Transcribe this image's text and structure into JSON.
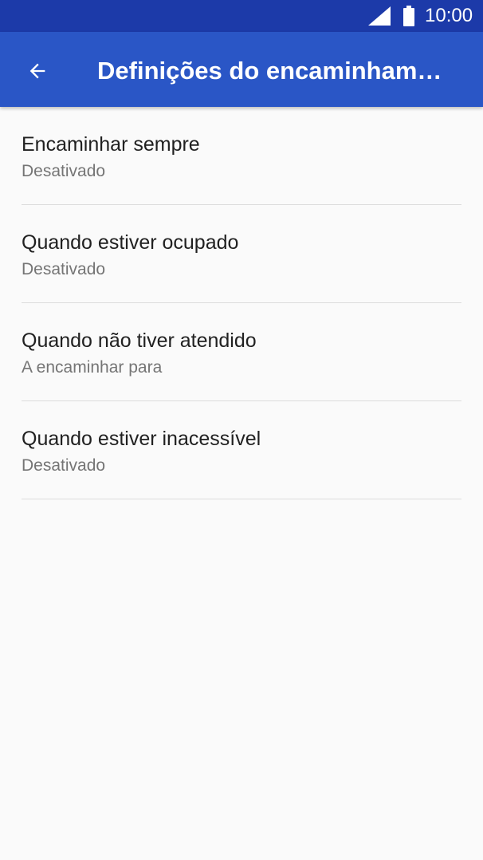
{
  "status_bar": {
    "time": "10:00",
    "signal_icon": "cell-signal-icon",
    "battery_icon": "battery-full-icon"
  },
  "app_bar": {
    "back_icon": "arrow-back-icon",
    "title": "Definições do encaminham…"
  },
  "settings": [
    {
      "title": "Encaminhar sempre",
      "summary": "Desativado"
    },
    {
      "title": "Quando estiver ocupado",
      "summary": "Desativado"
    },
    {
      "title": "Quando não tiver atendido",
      "summary": "A encaminhar para"
    },
    {
      "title": "Quando estiver inacessível",
      "summary": "Desativado"
    }
  ],
  "colors": {
    "status_bar": "#1c3aa9",
    "app_bar": "#2a56c6",
    "background": "#fafafa",
    "primary_text": "#212121",
    "secondary_text": "#757575",
    "divider": "#dcdcdc"
  }
}
